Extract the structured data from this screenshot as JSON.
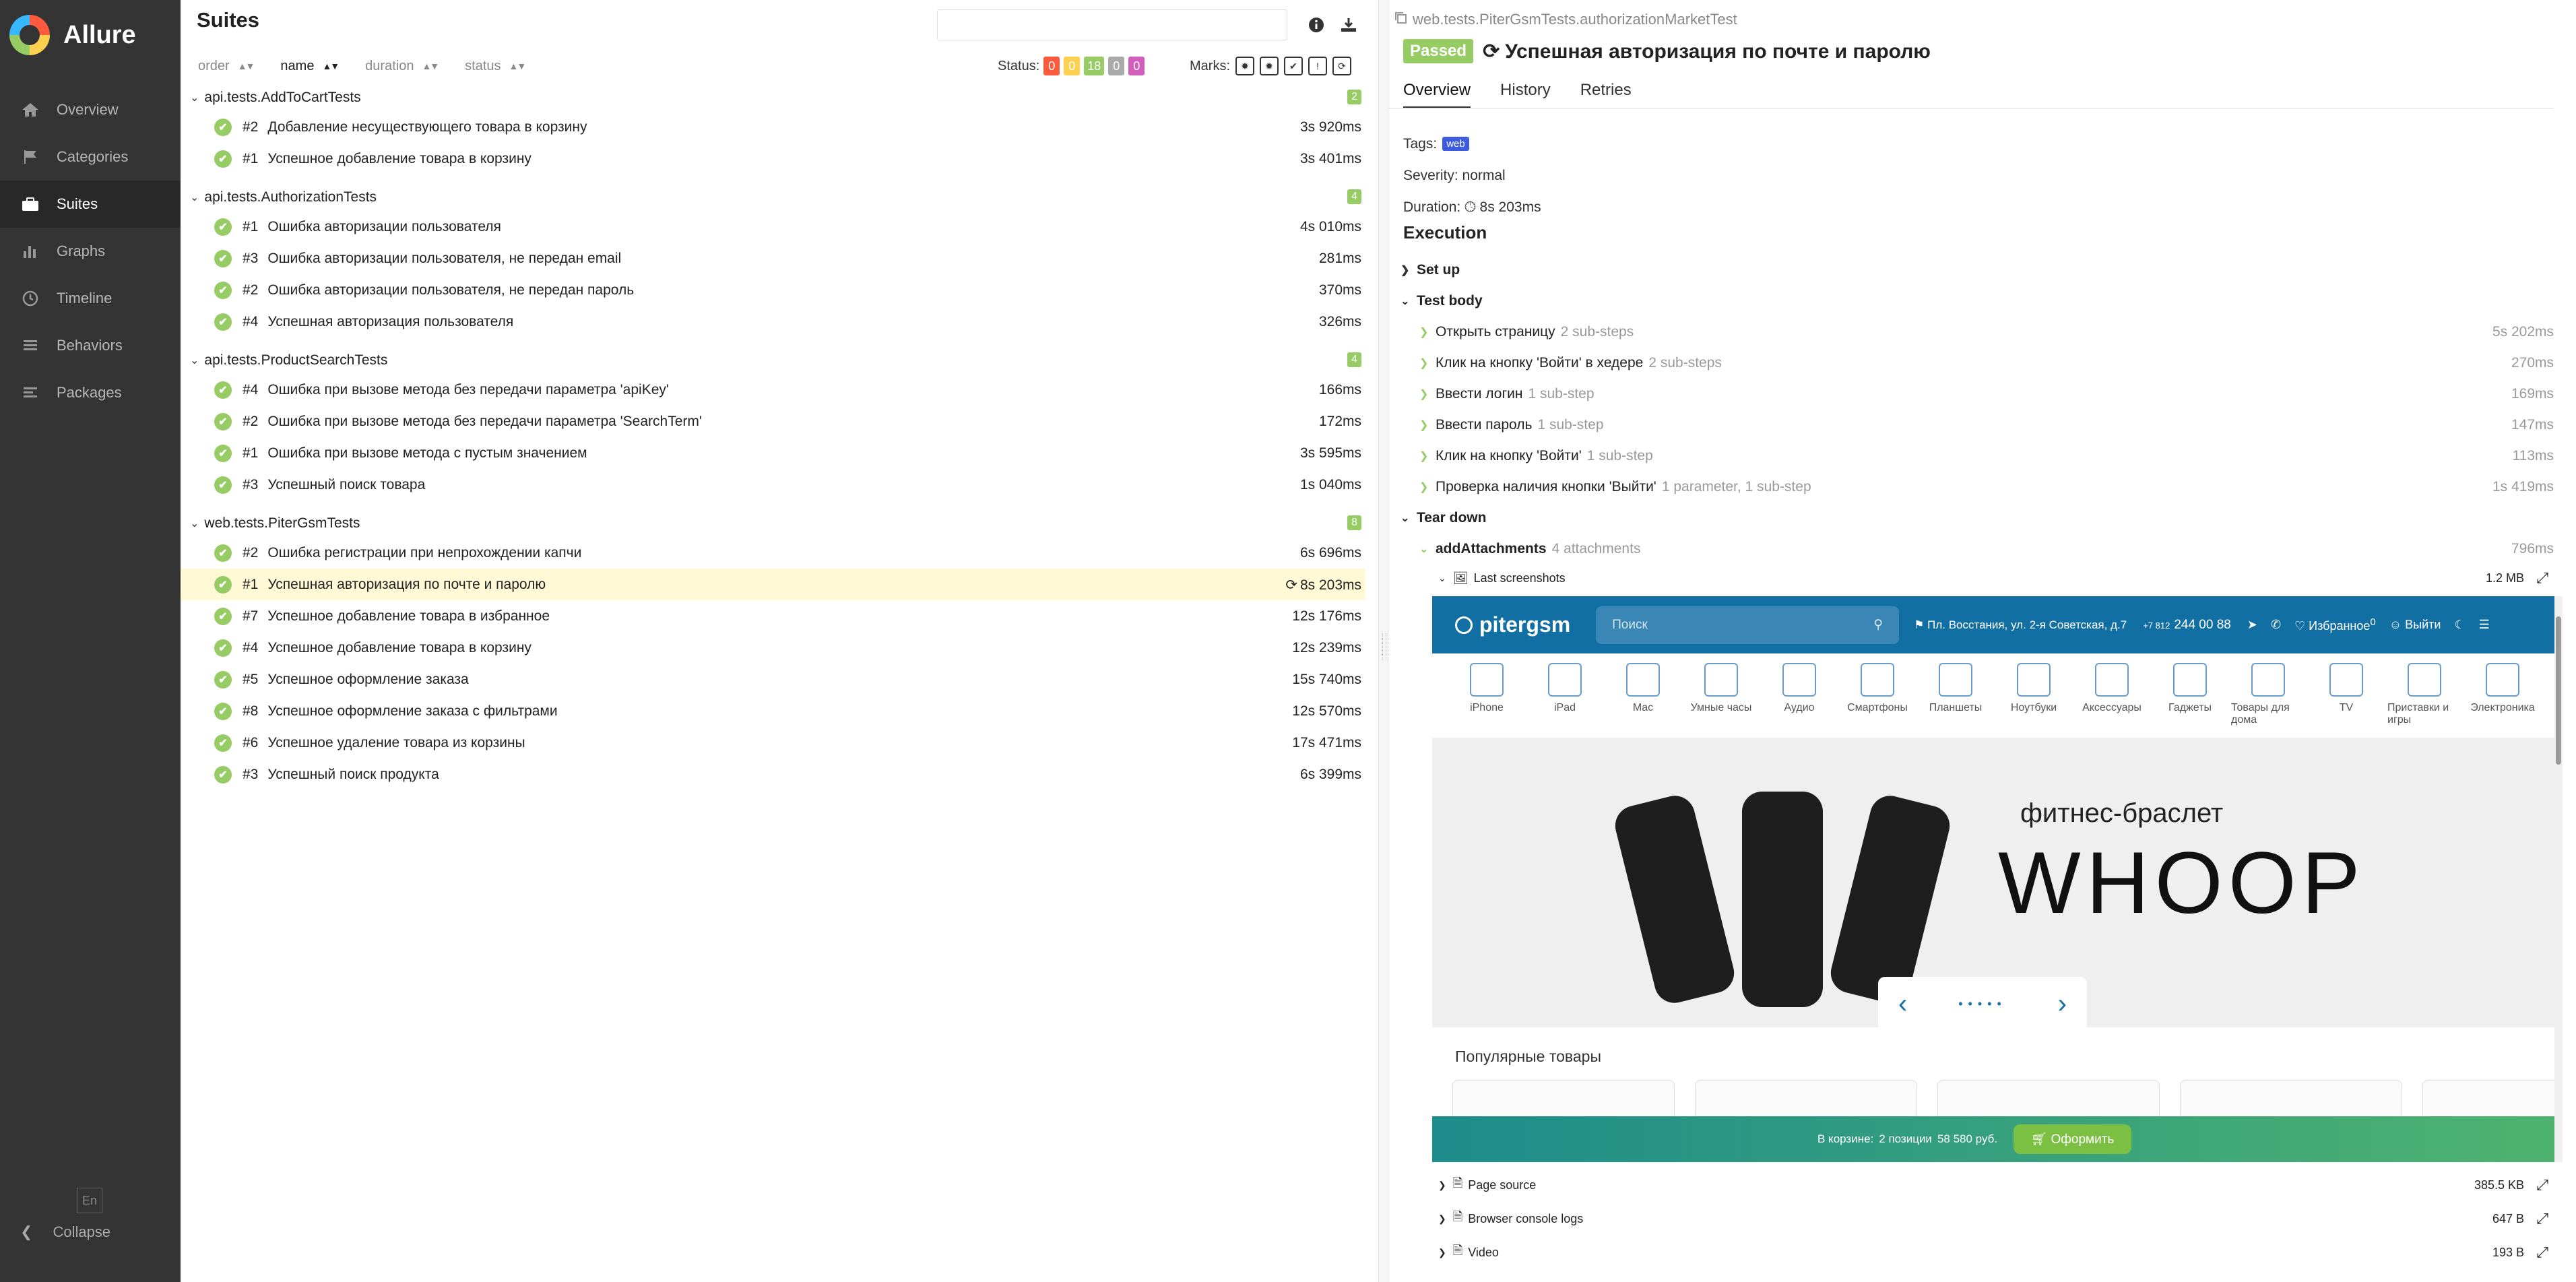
{
  "sidebar": {
    "brand": "Allure",
    "items": [
      {
        "label": "Overview",
        "icon": "home-icon"
      },
      {
        "label": "Categories",
        "icon": "flag-icon"
      },
      {
        "label": "Suites",
        "icon": "briefcase-icon"
      },
      {
        "label": "Graphs",
        "icon": "bar-chart-icon"
      },
      {
        "label": "Timeline",
        "icon": "clock-icon"
      },
      {
        "label": "Behaviors",
        "icon": "list-icon"
      },
      {
        "label": "Packages",
        "icon": "align-left-icon"
      }
    ],
    "active": "Suites",
    "lang": "En",
    "collapse": "Collapse"
  },
  "suites": {
    "title": "Suites",
    "search_placeholder": "",
    "sort": {
      "order": "order",
      "name": "name",
      "duration": "duration",
      "status": "status"
    },
    "status_label": "Status:",
    "status_counts": [
      {
        "value": "0",
        "color": "#fd5a3e"
      },
      {
        "value": "0",
        "color": "#ffd050"
      },
      {
        "value": "18",
        "color": "#97cc64"
      },
      {
        "value": "0",
        "color": "#aaaaaa"
      },
      {
        "value": "0",
        "color": "#d35ebe"
      }
    ],
    "marks_label": "Marks:",
    "groups": [
      {
        "name": "api.tests.AddToCartTests",
        "count": "2",
        "rows": [
          {
            "num": "#2",
            "name": "Добавление несуществующего товара в корзину",
            "dur": "3s 920ms"
          },
          {
            "num": "#1",
            "name": "Успешное добавление товара в корзину",
            "dur": "3s 401ms"
          }
        ]
      },
      {
        "name": "api.tests.AuthorizationTests",
        "count": "4",
        "rows": [
          {
            "num": "#1",
            "name": "Ошибка авторизации пользователя",
            "dur": "4s 010ms"
          },
          {
            "num": "#3",
            "name": "Ошибка авторизации пользователя, не передан email",
            "dur": "281ms"
          },
          {
            "num": "#2",
            "name": "Ошибка авторизации пользователя, не передан пароль",
            "dur": "370ms"
          },
          {
            "num": "#4",
            "name": "Успешная авторизация пользователя",
            "dur": "326ms"
          }
        ]
      },
      {
        "name": "api.tests.ProductSearchTests",
        "count": "4",
        "rows": [
          {
            "num": "#4",
            "name": "Ошибка при вызове метода без передачи параметра 'apiKey'",
            "dur": "166ms"
          },
          {
            "num": "#2",
            "name": "Ошибка при вызове метода без передачи параметра 'SearchTerm'",
            "dur": "172ms"
          },
          {
            "num": "#1",
            "name": "Ошибка при вызове метода с пустым значением",
            "dur": "3s 595ms"
          },
          {
            "num": "#3",
            "name": "Успешный поиск товара",
            "dur": "1s 040ms"
          }
        ]
      },
      {
        "name": "web.tests.PiterGsmTests",
        "count": "8",
        "rows": [
          {
            "num": "#2",
            "name": "Ошибка регистрации при непрохождении капчи",
            "dur": "6s 696ms"
          },
          {
            "num": "#1",
            "name": "Успешная авторизация по почте и паролю",
            "dur": "8s 203ms"
          },
          {
            "num": "#7",
            "name": "Успешное добавление товара в избранное",
            "dur": "12s 176ms"
          },
          {
            "num": "#4",
            "name": "Успешное добавление товара в корзину",
            "dur": "12s 239ms"
          },
          {
            "num": "#5",
            "name": "Успешное оформление заказа",
            "dur": "15s 740ms"
          },
          {
            "num": "#8",
            "name": "Успешное оформление заказа с фильтрами",
            "dur": "12s 570ms"
          },
          {
            "num": "#6",
            "name": "Успешное удаление товара из корзины",
            "dur": "17s 471ms"
          },
          {
            "num": "#3",
            "name": "Успешный поиск продукта",
            "dur": "6s 399ms"
          }
        ]
      }
    ]
  },
  "detail": {
    "breadcrumb": "web.tests.PiterGsmTests.authorizationMarketTest",
    "status": "Passed",
    "title": "Успешная авторизация по почте и паролю",
    "tabs": [
      "Overview",
      "History",
      "Retries"
    ],
    "tags_label": "Tags:",
    "tag": "web",
    "severity": "Severity: normal",
    "duration_label": "Duration:",
    "duration": "8s 203ms",
    "execution": "Execution",
    "setup": "Set up",
    "test_body": "Test body",
    "steps": [
      {
        "name": "Открыть страницу",
        "sub": "2 sub-steps",
        "dur": "5s 202ms"
      },
      {
        "name": "Клик на кнопку 'Войти' в хедере",
        "sub": "2 sub-steps",
        "dur": "270ms"
      },
      {
        "name": "Ввести логин",
        "sub": "1 sub-step",
        "dur": "169ms"
      },
      {
        "name": "Ввести пароль",
        "sub": "1 sub-step",
        "dur": "147ms"
      },
      {
        "name": "Клик на кнопку 'Войти'",
        "sub": "1 sub-step",
        "dur": "113ms"
      },
      {
        "name": "Проверка наличия кнопки 'Выйти'",
        "sub": "1 parameter, 1 sub-step",
        "dur": "1s 419ms"
      }
    ],
    "tear_down": "Tear down",
    "add_attachments": "addAttachments",
    "attachments_count": "4 attachments",
    "add_attachments_dur": "796ms",
    "attachments": [
      {
        "name": "Last screenshots",
        "size": "1.2 MB"
      },
      {
        "name": "Page source",
        "size": "385.5 KB"
      },
      {
        "name": "Browser console logs",
        "size": "647 B"
      },
      {
        "name": "Video",
        "size": "193 B"
      }
    ]
  },
  "screenshot": {
    "logo": "pitergsm",
    "search_placeholder": "Поиск",
    "address": "Пл. Восстания, ул. 2-я Советская, д.7",
    "phone_prefix": "+7 812",
    "phone": "244 00 88",
    "favorites": "Избранное",
    "favorites_count": "0",
    "logout": "Выйти",
    "categories": [
      "iPhone",
      "iPad",
      "Mac",
      "Умные часы",
      "Аудио",
      "Смартфоны",
      "Планшеты",
      "Ноутбуки",
      "Аксессуары",
      "Гаджеты",
      "Товары для дома",
      "TV",
      "Приставки и игры",
      "Электроника"
    ],
    "hero_sub": "фитнес-браслет",
    "hero_brand": "WHOOP",
    "popular": "Популярные товары",
    "cart_text": "В корзине:",
    "cart_items": "2 позиции",
    "cart_sum": "58 580 руб.",
    "order": "Оформить"
  }
}
